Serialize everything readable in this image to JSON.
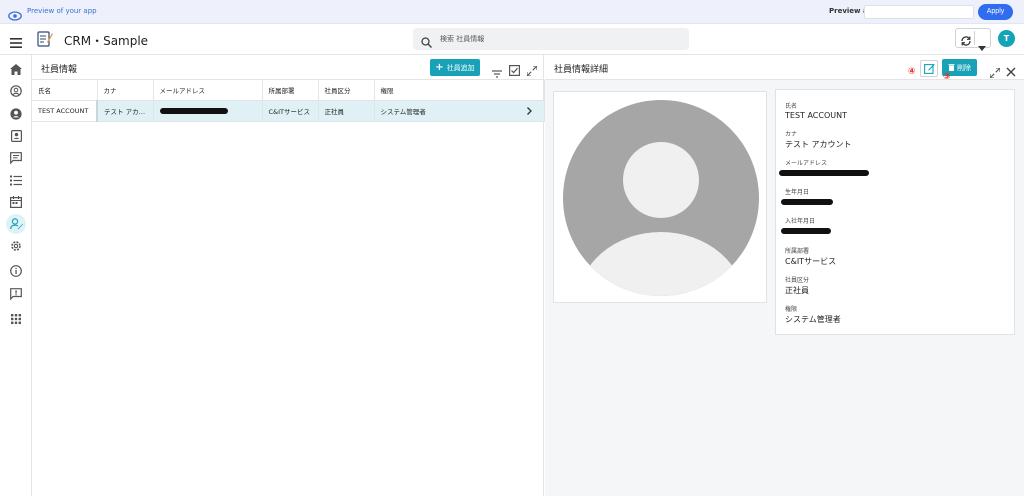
{
  "preview_bar": {
    "text": "Preview of your app",
    "preview_as_label": "Preview as:",
    "apply_label": "Apply"
  },
  "header": {
    "app_title": "CRM・Sample",
    "search_placeholder": "検索 社員情報",
    "avatar_initial": "T"
  },
  "sidebar": {
    "items": [
      "home-icon",
      "account-circle-icon",
      "person-circle-icon",
      "contact-card-icon",
      "chat-icon",
      "task-list-icon",
      "calendar-icon",
      "employee-icon",
      "settings-icon",
      "info-icon",
      "feedback-icon",
      "apps-grid-icon"
    ],
    "active_index": 7
  },
  "list_pane": {
    "title": "社員情報",
    "add_label": "社員追加",
    "columns": [
      "氏名",
      "カナ",
      "メールアドレス",
      "所属部署",
      "社員区分",
      "権限"
    ],
    "rows": [
      {
        "name": "TEST ACCOUNT",
        "kana": "テスト アカ…",
        "email": "",
        "department": "C&ITサービス",
        "category": "正社員",
        "role": "システム管理者"
      }
    ]
  },
  "detail_pane": {
    "title": "社員情報詳細",
    "delete_label": "削除",
    "annotation_edit": "④",
    "annotation_delete": "③",
    "fields": [
      {
        "label": "氏名",
        "value": "TEST ACCOUNT"
      },
      {
        "label": "カナ",
        "value": "テスト アカウント"
      },
      {
        "label": "メールアドレス",
        "value": ""
      },
      {
        "label": "生年月日",
        "value": ""
      },
      {
        "label": "入社年月日",
        "value": ""
      },
      {
        "label": "所属部署",
        "value": "C&ITサービス"
      },
      {
        "label": "社員区分",
        "value": "正社員"
      },
      {
        "label": "権限",
        "value": "システム管理者"
      }
    ]
  },
  "colors": {
    "accent": "#17a2b8",
    "apply": "#2f6cf0",
    "selected_row": "#dff1f4",
    "annotation": "#e0301e"
  }
}
